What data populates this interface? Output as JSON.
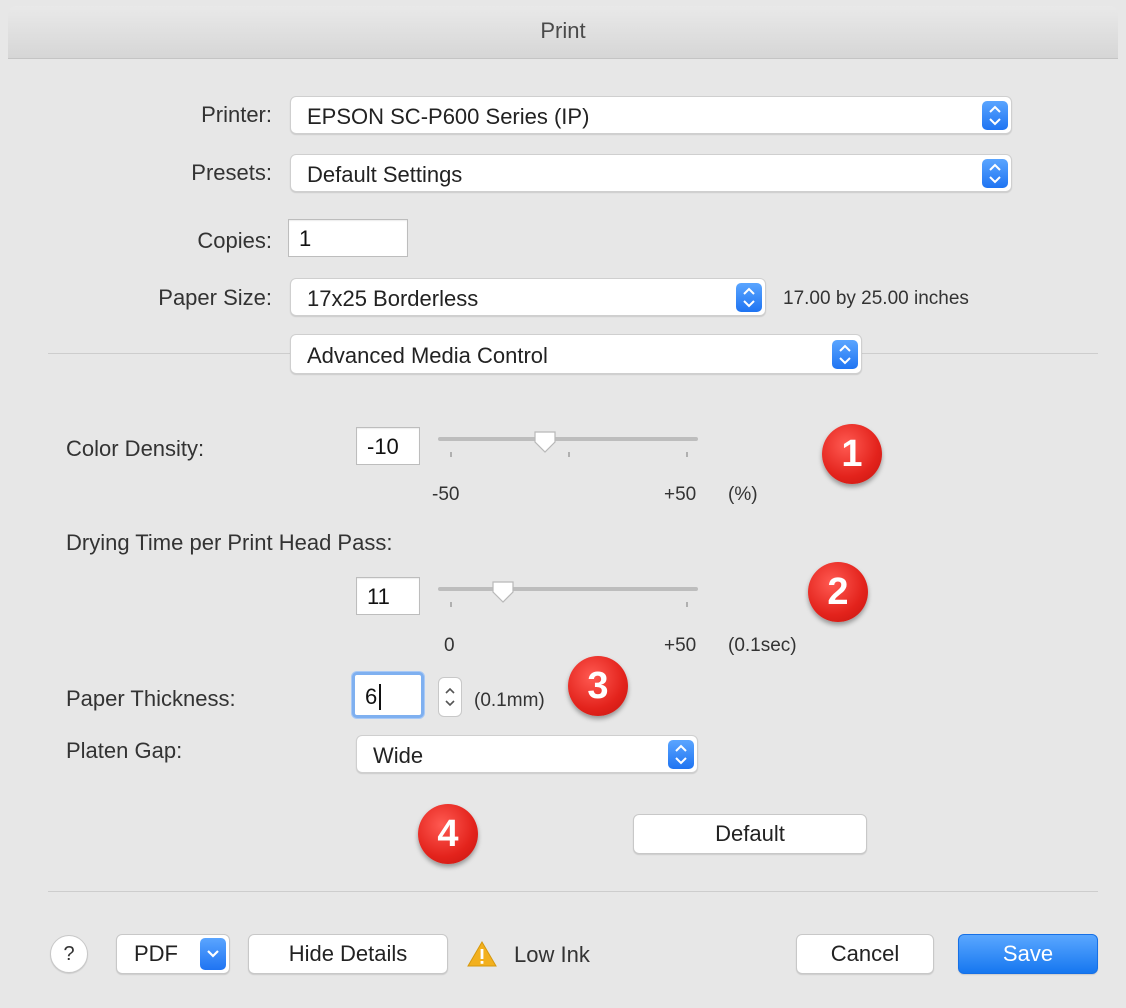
{
  "window": {
    "title": "Print"
  },
  "printer": {
    "label": "Printer:",
    "value": "EPSON SC-P600 Series (IP)"
  },
  "presets": {
    "label": "Presets:",
    "value": "Default Settings"
  },
  "copies": {
    "label": "Copies:",
    "value": "1"
  },
  "paper_size": {
    "label": "Paper Size:",
    "value": "17x25 Borderless",
    "dimensions": "17.00 by 25.00 inches"
  },
  "panel_selector": {
    "value": "Advanced Media Control"
  },
  "color_density": {
    "label": "Color Density:",
    "value": "-10",
    "min_label": "-50",
    "max_label": "+50",
    "unit": "(%)",
    "min": -50,
    "max": 50,
    "current": -10
  },
  "drying_time": {
    "label": "Drying Time per Print Head Pass:",
    "value": "11",
    "min_label": "0",
    "max_label": "+50",
    "unit": "(0.1sec)",
    "min": 0,
    "max": 50,
    "current": 11
  },
  "paper_thickness": {
    "label": "Paper Thickness:",
    "value": "6",
    "unit": "(0.1mm)"
  },
  "platen_gap": {
    "label": "Platen Gap:",
    "value": "Wide"
  },
  "default_button": {
    "label": "Default"
  },
  "badges": [
    "1",
    "2",
    "3",
    "4"
  ],
  "footer": {
    "help": "?",
    "pdf": "PDF",
    "hide_details": "Hide Details",
    "warning_text": "Low Ink",
    "cancel": "Cancel",
    "save": "Save"
  },
  "colors": {
    "accent": "#1f74f2",
    "badge": "#e3231c",
    "warning": "#f2b01e"
  }
}
